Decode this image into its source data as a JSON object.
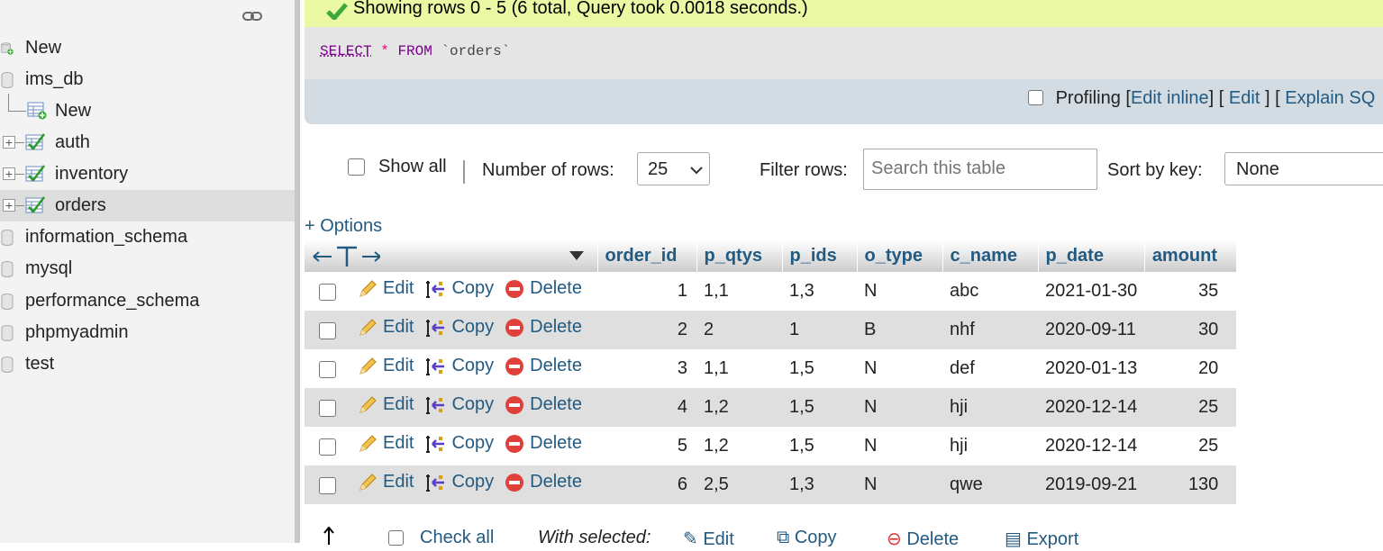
{
  "sidebar": {
    "items": [
      {
        "label": "New",
        "type": "new"
      },
      {
        "label": "ims_db",
        "type": "db"
      },
      {
        "label": "New",
        "type": "new-table"
      },
      {
        "label": "auth",
        "type": "table"
      },
      {
        "label": "inventory",
        "type": "table"
      },
      {
        "label": "orders",
        "type": "table",
        "selected": true
      },
      {
        "label": "information_schema",
        "type": "db"
      },
      {
        "label": "mysql",
        "type": "db"
      },
      {
        "label": "performance_schema",
        "type": "db"
      },
      {
        "label": "phpmyadmin",
        "type": "db"
      },
      {
        "label": "test",
        "type": "db"
      }
    ]
  },
  "result": {
    "message": "Showing rows 0 - 5 (6 total, Query took 0.0018 seconds.)",
    "sql": {
      "select": "SELECT",
      "star": "*",
      "from": "FROM",
      "table": "`orders`"
    }
  },
  "tools": {
    "profiling": "Profiling",
    "edit_inline": "Edit inline",
    "edit": "Edit",
    "explain": "Explain SQ"
  },
  "nav": {
    "show_all": "Show all",
    "num_rows_label": "Number of rows:",
    "num_rows_value": "25",
    "filter_label": "Filter rows:",
    "filter_placeholder": "Search this table",
    "sort_label": "Sort by key:",
    "sort_value": "None"
  },
  "options_label": "+ Options",
  "table": {
    "columns": [
      "order_id",
      "p_qtys",
      "p_ids",
      "o_type",
      "c_name",
      "p_date",
      "amount"
    ],
    "actions": {
      "edit": "Edit",
      "copy": "Copy",
      "delete": "Delete"
    },
    "rows": [
      [
        "1",
        "1,1",
        "1,3",
        "N",
        "abc",
        "2021-01-30",
        "35"
      ],
      [
        "2",
        "2",
        "1",
        "B",
        "nhf",
        "2020-09-11",
        "30"
      ],
      [
        "3",
        "1,1",
        "1,5",
        "N",
        "def",
        "2020-01-13",
        "20"
      ],
      [
        "4",
        "1,2",
        "1,5",
        "N",
        "hji",
        "2020-12-14",
        "25"
      ],
      [
        "5",
        "1,2",
        "1,5",
        "N",
        "hji",
        "2020-12-14",
        "25"
      ],
      [
        "6",
        "2,5",
        "1,3",
        "N",
        "qwe",
        "2019-09-21",
        "130"
      ]
    ]
  },
  "bottom": {
    "check_all": "Check all",
    "with_selected": "With selected:",
    "edit": "Edit",
    "copy": "Copy",
    "delete": "Delete",
    "export": "Export"
  },
  "colors": {
    "success_bg": "#ebf8a4",
    "link": "#235a81",
    "header_bg": "#d3dce3"
  }
}
